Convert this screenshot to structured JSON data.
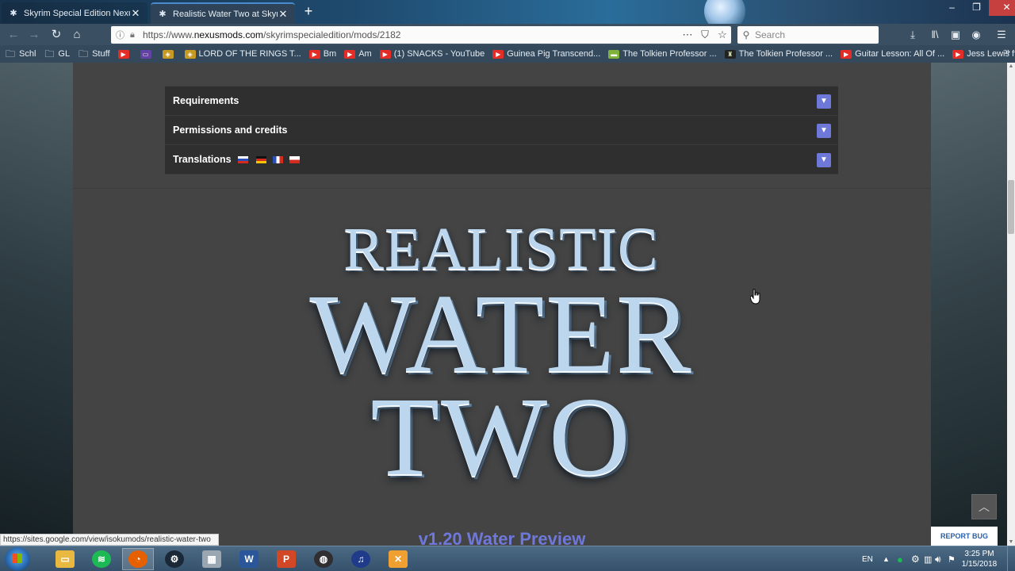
{
  "browser": {
    "tabs": [
      {
        "title": "Skyrim Special Edition Nexus -",
        "active": false
      },
      {
        "title": "Realistic Water Two at Skyrim S",
        "active": true
      }
    ],
    "url_prefix": "https://www.",
    "url_domain": "nexusmods.com",
    "url_path": "/skyrimspecialedition/mods/2182",
    "search_placeholder": "Search",
    "bookmarks": [
      {
        "label": "Schl",
        "icon": "folder"
      },
      {
        "label": "GL",
        "icon": "folder"
      },
      {
        "label": "Stuff",
        "icon": "folder"
      },
      {
        "label": "",
        "icon": "youtube"
      },
      {
        "label": "",
        "icon": "twitch"
      },
      {
        "label": "",
        "icon": "gold"
      },
      {
        "label": "LORD OF THE RINGS T...",
        "icon": "gold"
      },
      {
        "label": "Bm",
        "icon": "youtube"
      },
      {
        "label": "Am",
        "icon": "youtube"
      },
      {
        "label": "(1) SNACKS - YouTube",
        "icon": "youtube"
      },
      {
        "label": "Guinea Pig Transcend...",
        "icon": "youtube"
      },
      {
        "label": "The Tolkien Professor ...",
        "icon": "green"
      },
      {
        "label": "The Tolkien Professor ...",
        "icon": "dark"
      },
      {
        "label": "Guitar Lesson: All Of ...",
        "icon": "youtube"
      },
      {
        "label": "Jess Lewis ft. Alex Hut...",
        "icon": "youtube"
      }
    ],
    "status_link": "https://sites.google.com/view/isokumods/realistic-water-two"
  },
  "page": {
    "accordion": [
      {
        "label": "Requirements"
      },
      {
        "label": "Permissions and credits"
      },
      {
        "label": "Translations"
      }
    ],
    "logo": {
      "line1": "REALISTIC",
      "line2": "WATER",
      "line3": "TWO"
    },
    "preview_title": "v1.20 Water Preview",
    "report_bug": "REPORT BUG",
    "scroll_top_icon": "chevron-up-icon"
  },
  "taskbar": {
    "apps": [
      "file-explorer",
      "spotify",
      "firefox",
      "steam",
      "calculator",
      "word",
      "powerpoint",
      "obs",
      "audacity",
      "game"
    ],
    "language": "EN",
    "time": "3:25 PM",
    "date": "1/15/2018"
  },
  "colors": {
    "accent": "#6e78d8",
    "panel": "#2f2f2f",
    "content_bg": "#444444"
  }
}
